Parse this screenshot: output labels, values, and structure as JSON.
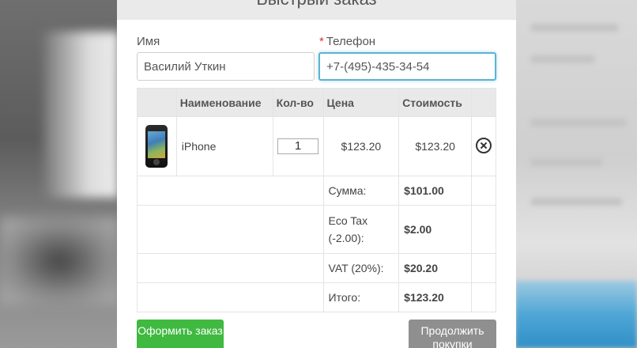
{
  "modal": {
    "title": "Быстрый заказ"
  },
  "form": {
    "name_label": "Имя",
    "name_value": "Василий Уткин",
    "phone_required_mark": "*",
    "phone_label": "Телефон",
    "phone_value": "+7-(495)-435-34-54"
  },
  "cart": {
    "headers": {
      "name": "Наименование",
      "qty": "Кол-во",
      "price": "Цена",
      "total": "Стоимость"
    },
    "items": [
      {
        "name": "iPhone",
        "qty": "1",
        "price": "$123.20",
        "total": "$123.20"
      }
    ],
    "totals": [
      {
        "label": "Сумма:",
        "value": "$101.00"
      },
      {
        "label": "Eco Tax (-2.00):",
        "value": "$2.00"
      },
      {
        "label": "VAT (20%):",
        "value": "$20.20"
      },
      {
        "label": "Итого:",
        "value": "$123.20"
      }
    ]
  },
  "actions": {
    "checkout_label": "Оформить заказ",
    "continue_label": "Продолжить покупки"
  },
  "colors": {
    "checkout": "#3fb93f",
    "continue": "#8f8f8f",
    "focus_border": "#5ab4d4"
  }
}
